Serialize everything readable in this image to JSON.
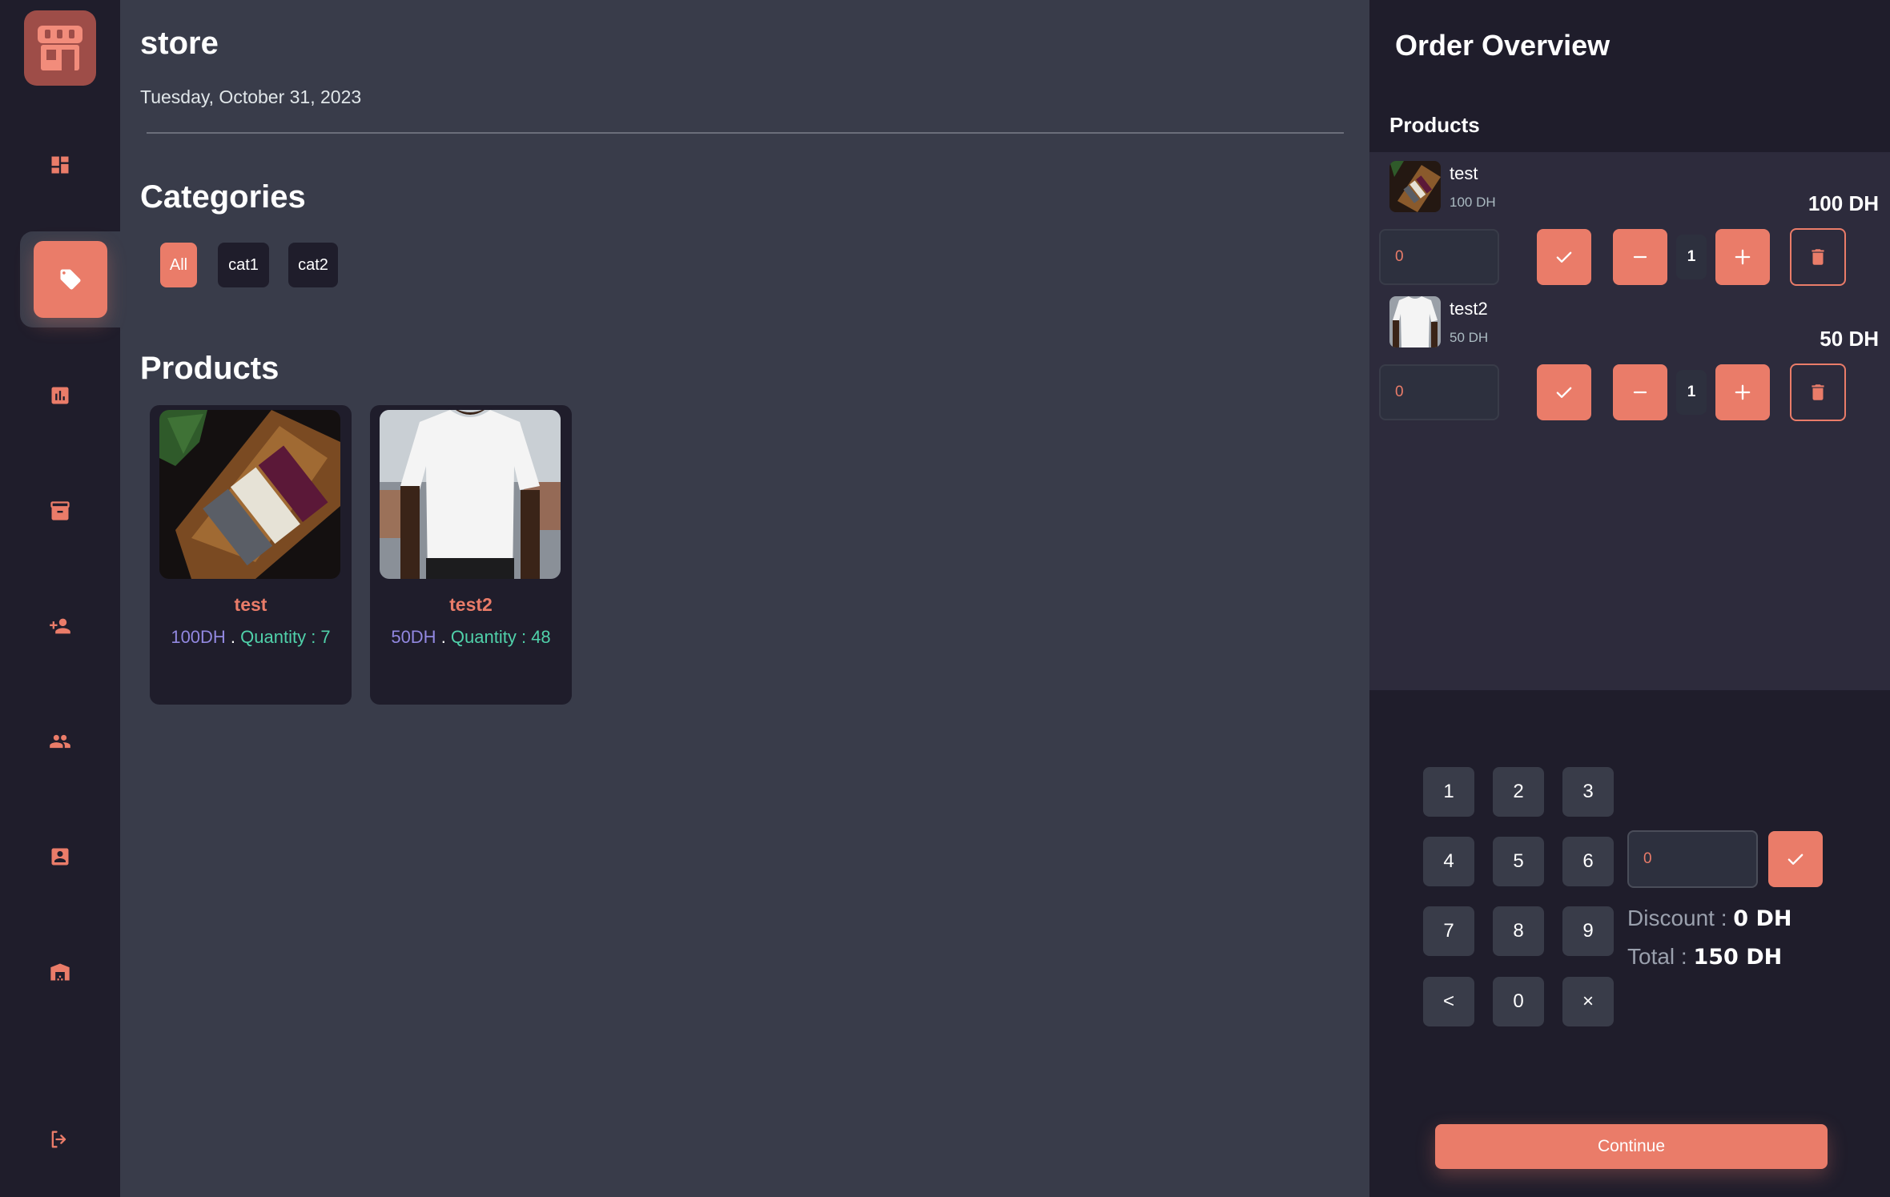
{
  "store": {
    "title": "store",
    "date": "Tuesday, October 31, 2023"
  },
  "categories": {
    "title": "Categories",
    "items": [
      {
        "label": "All",
        "active": true
      },
      {
        "label": "cat1",
        "active": false
      },
      {
        "label": "cat2",
        "active": false
      }
    ]
  },
  "products": {
    "title": "Products",
    "items": [
      {
        "name": "test",
        "price": "100DH",
        "separator": " . ",
        "quantity": "Quantity : 7"
      },
      {
        "name": "test2",
        "price": "50DH",
        "separator": " . ",
        "quantity": "Quantity : 48"
      }
    ]
  },
  "sidebar": {
    "items": [
      {
        "icon": "dashboard-icon"
      },
      {
        "icon": "tag-icon",
        "active": true
      },
      {
        "icon": "chart-icon"
      },
      {
        "icon": "archive-icon"
      },
      {
        "icon": "add-user-icon"
      },
      {
        "icon": "group-icon"
      },
      {
        "icon": "contact-icon"
      },
      {
        "icon": "warehouse-icon"
      },
      {
        "icon": "logout-icon"
      }
    ]
  },
  "order": {
    "title": "Order Overview",
    "products_label": "Products",
    "lines": [
      {
        "name": "test",
        "unit_price": "100 DH",
        "line_total": "100 DH",
        "note_value": "0",
        "qty": "1"
      },
      {
        "name": "test2",
        "unit_price": "50 DH",
        "line_total": "50 DH",
        "note_value": "0",
        "qty": "1"
      }
    ],
    "keypad": [
      "1",
      "2",
      "3",
      "4",
      "5",
      "6",
      "7",
      "8",
      "9",
      "<",
      "0",
      "×"
    ],
    "discount_input_value": "0",
    "discount_label": "Discount : ",
    "discount_value": "0 DH",
    "total_label": "Total : ",
    "total_value": "150 DH",
    "continue_label": "Continue"
  },
  "colors": {
    "accent": "#ea7c69",
    "background": "#393c4a",
    "panel": "#1f1d2b",
    "price": "#9288e0",
    "quantity": "#50d1aa"
  }
}
